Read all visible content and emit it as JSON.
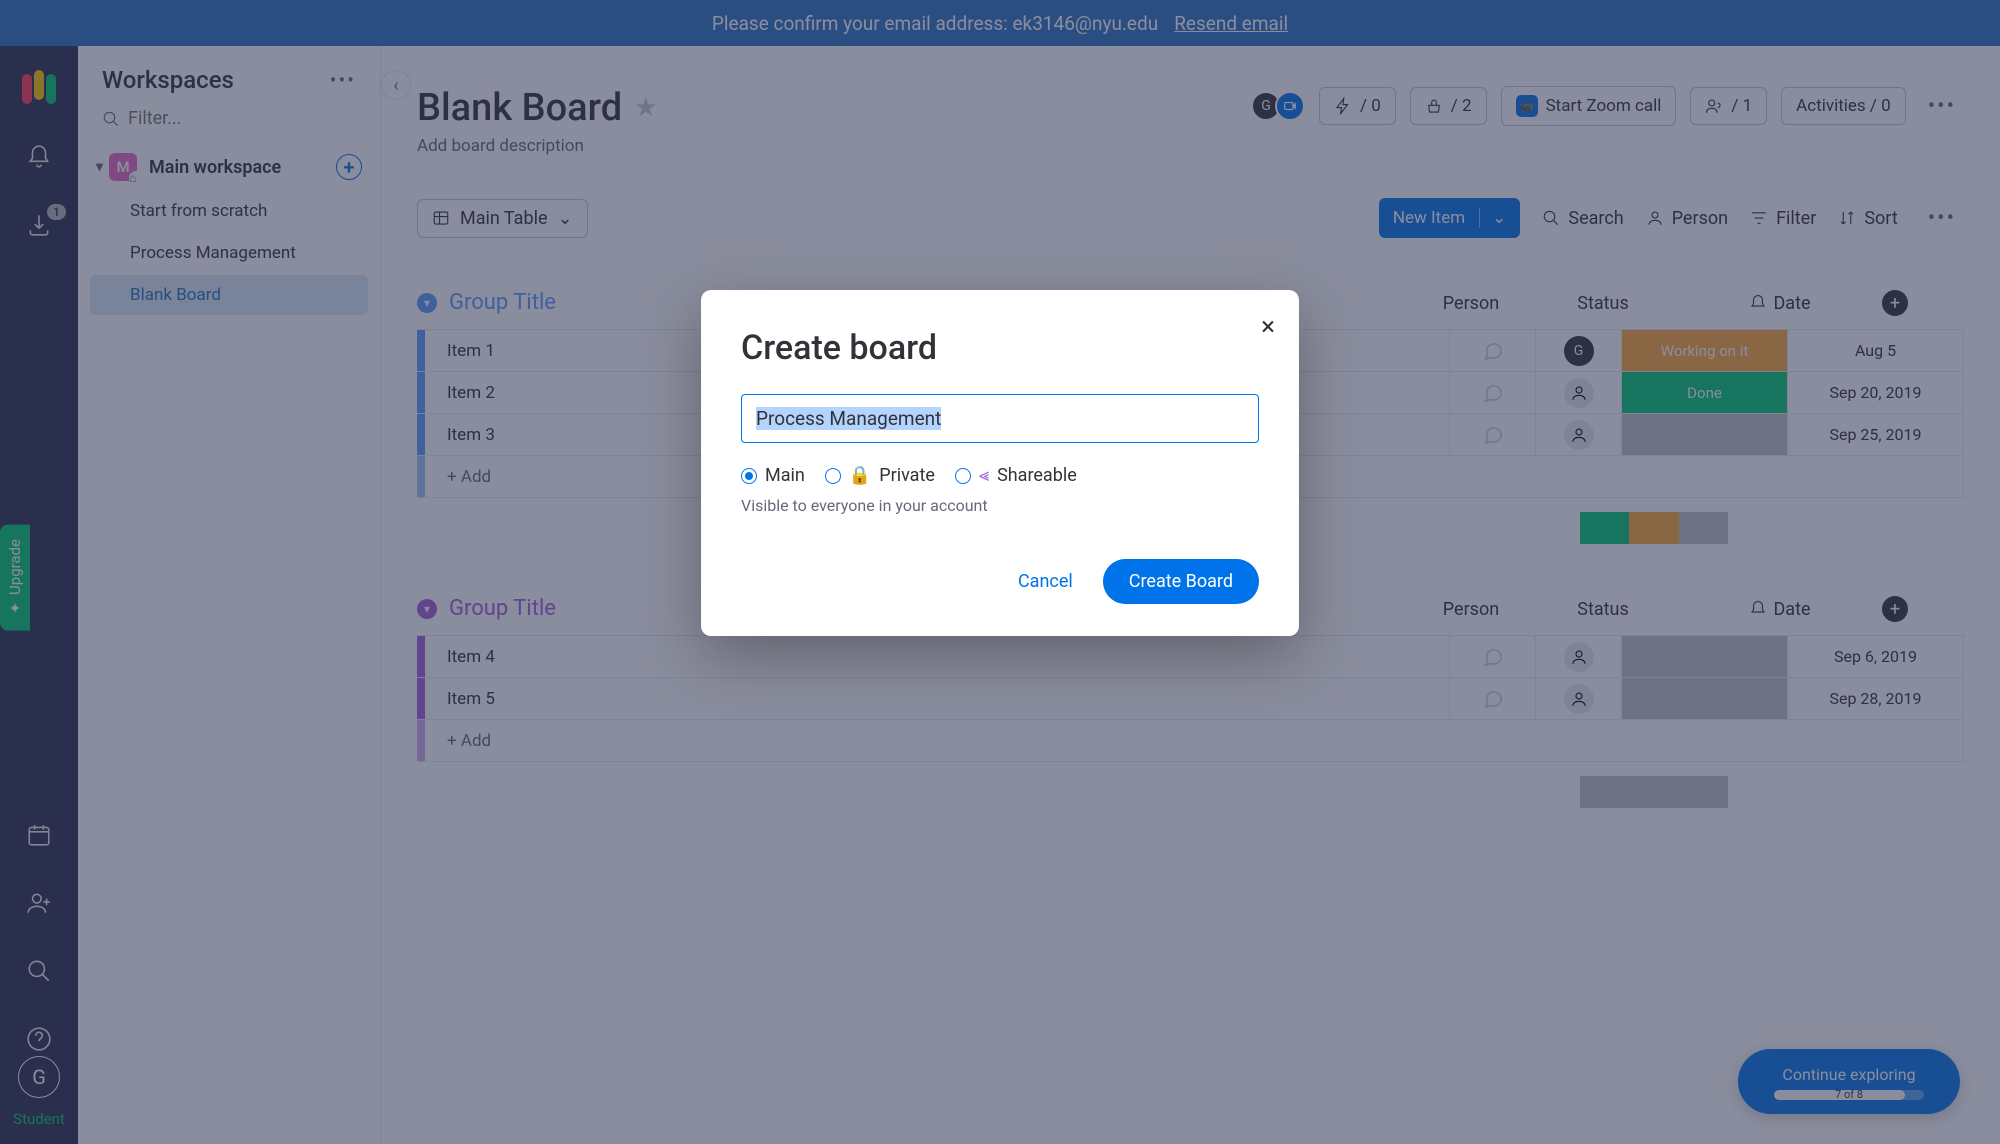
{
  "banner": {
    "text": "Please confirm your email address: ek3146@nyu.edu",
    "resend": "Resend email"
  },
  "rail": {
    "inbox_badge": "1",
    "avatar": "G",
    "student": "Student",
    "upgrade": "Upgrade"
  },
  "sidebar": {
    "title": "Workspaces",
    "filter_placeholder": "Filter...",
    "workspace": {
      "initial": "M",
      "name": "Main workspace"
    },
    "items": [
      "Start from scratch",
      "Process Management",
      "Blank Board"
    ]
  },
  "board": {
    "title": "Blank Board",
    "desc": "Add board description",
    "thunder": "/ 0",
    "hand": "/ 2",
    "zoom": "Start Zoom call",
    "people": "/ 1",
    "activities": "Activities / 0",
    "view": "Main Table",
    "new_item": "New Item",
    "tools": {
      "search": "Search",
      "person": "Person",
      "filter": "Filter",
      "sort": "Sort"
    }
  },
  "columns": {
    "person": "Person",
    "status": "Status",
    "date": "Date"
  },
  "statuses": {
    "working": "Working on it",
    "done": "Done"
  },
  "groups": [
    {
      "title": "Group Title",
      "color": "blue",
      "rows": [
        {
          "name": "Item 1",
          "person": "G",
          "status": "working",
          "date": "Aug 5"
        },
        {
          "name": "Item 2",
          "person": "",
          "status": "done",
          "date": "Sep 20, 2019"
        },
        {
          "name": "Item 3",
          "person": "",
          "status": "empty",
          "date": "Sep 25, 2019"
        }
      ],
      "add": "+ Add"
    },
    {
      "title": "Group Title",
      "color": "purple",
      "rows": [
        {
          "name": "Item 4",
          "person": "",
          "status": "empty",
          "date": "Sep 6, 2019"
        },
        {
          "name": "Item 5",
          "person": "",
          "status": "empty",
          "date": "Sep 28, 2019"
        }
      ],
      "add": "+ Add"
    }
  ],
  "continue": {
    "label": "Continue exploring",
    "progress": "7 of 8"
  },
  "modal": {
    "title": "Create board",
    "input": "Process Management",
    "options": {
      "main": "Main",
      "private": "Private",
      "shareable": "Shareable"
    },
    "help": "Visible to everyone in your account",
    "cancel": "Cancel",
    "create": "Create Board"
  }
}
